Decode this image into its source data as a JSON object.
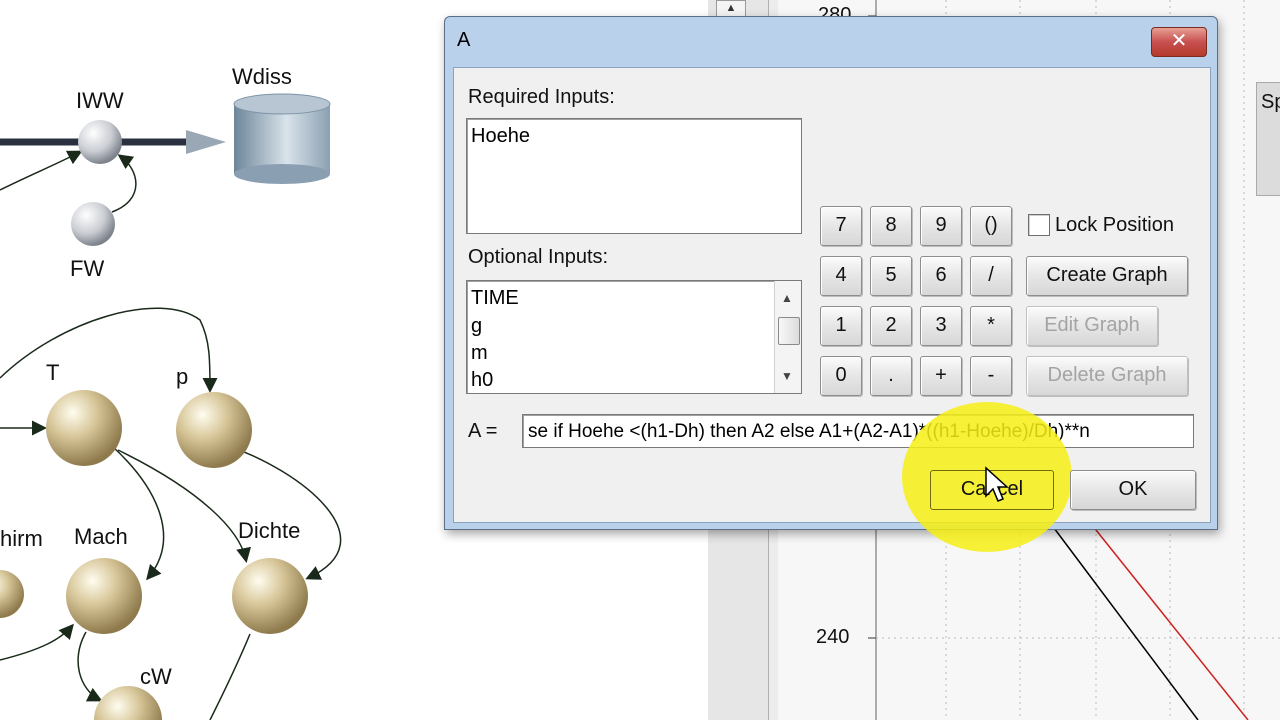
{
  "diagram": {
    "nodes": [
      {
        "id": "iww",
        "label": "IWW"
      },
      {
        "id": "wdiss",
        "label": "Wdiss"
      },
      {
        "id": "fw",
        "label": "FW"
      },
      {
        "id": "t",
        "label": "T"
      },
      {
        "id": "p",
        "label": "p"
      },
      {
        "id": "schirm",
        "label": "hirm"
      },
      {
        "id": "mach",
        "label": "Mach"
      },
      {
        "id": "dichte",
        "label": "Dichte"
      },
      {
        "id": "cw",
        "label": "cW"
      }
    ]
  },
  "background_chart": {
    "y_tick_240": "240",
    "y_tick_top": "280",
    "spec_label": "Sp",
    "series_colors": [
      "#000000",
      "#d02020"
    ]
  },
  "dialog": {
    "title": "A",
    "close_symbol": "✕",
    "required_inputs_label": "Required Inputs:",
    "required_inputs": [
      "Hoehe"
    ],
    "optional_inputs_label": "Optional Inputs:",
    "optional_inputs": [
      "TIME",
      "g",
      "m",
      "h0"
    ],
    "keypad": {
      "row1": [
        "7",
        "8",
        "9",
        "()"
      ],
      "row2": [
        "4",
        "5",
        "6",
        "/"
      ],
      "row3": [
        "1",
        "2",
        "3",
        "*"
      ],
      "row4": [
        "0",
        ".",
        "+",
        "-"
      ]
    },
    "lock_position_label": "Lock Position",
    "create_graph_label": "Create Graph",
    "edit_graph_label": "Edit Graph",
    "delete_graph_label": "Delete Graph",
    "formula_label": "A =",
    "formula_value": "se if Hoehe <(h1-Dh) then A2 else A1+(A2-A1)*((h1-Hoehe)/Dh)**n",
    "cancel_label": "Cancel",
    "ok_label": "OK"
  },
  "colors": {
    "titlebar": "#b9d1ea",
    "close_button": "#c75050",
    "highlight": "#f6ee14"
  }
}
